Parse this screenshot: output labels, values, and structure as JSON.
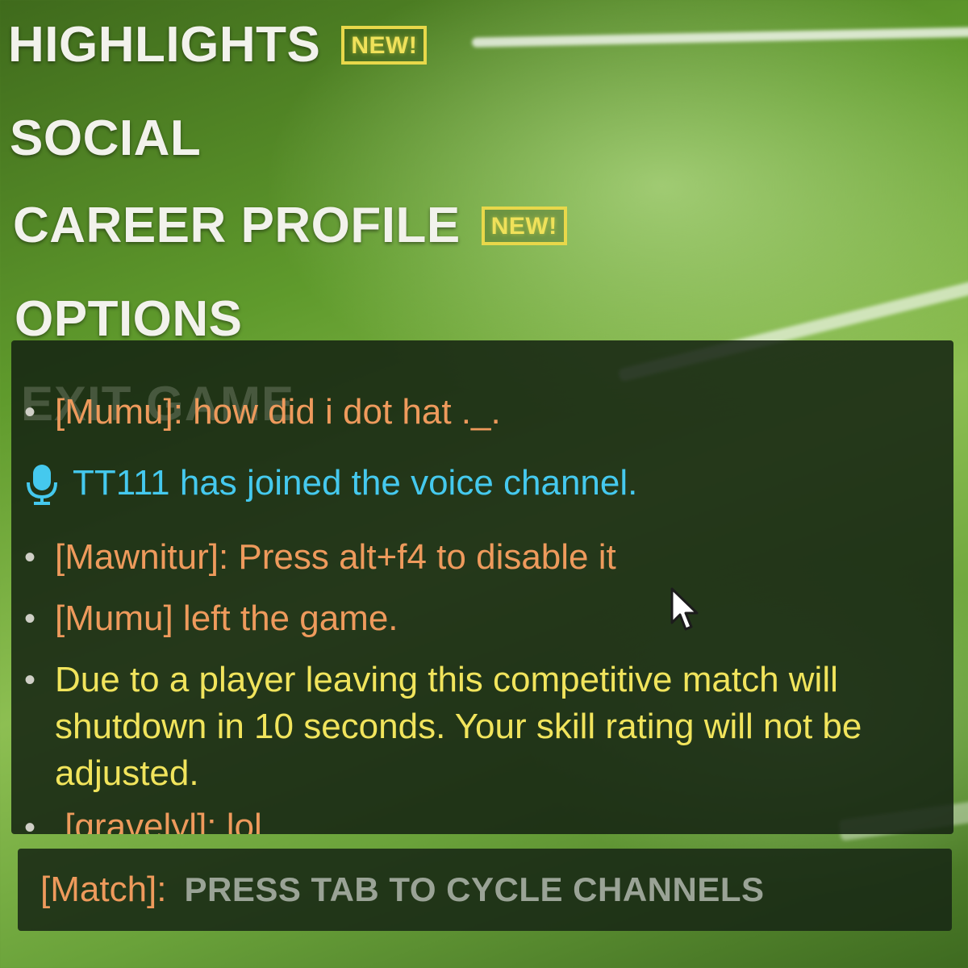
{
  "menu": {
    "items": [
      {
        "label": "HIGHLIGHTS",
        "badge": "NEW!"
      },
      {
        "label": "SOCIAL"
      },
      {
        "label": "CAREER PROFILE",
        "badge": "NEW!"
      },
      {
        "label": "OPTIONS"
      },
      {
        "label": "EXIT GAME"
      }
    ]
  },
  "chat": {
    "messages": [
      {
        "type": "player",
        "text": "[Mumu]: how did i dot hat ._."
      },
      {
        "type": "voice",
        "icon": "microphone-icon",
        "text": "TT111 has joined the voice channel."
      },
      {
        "type": "player",
        "text": "[Mawnitur]: Press alt+f4 to disable it"
      },
      {
        "type": "player",
        "text": "[Mumu] left the game."
      },
      {
        "type": "system",
        "text": "Due to a player leaving this competitive match will shutdown in 10 seconds. Your skill rating will not be adjusted."
      },
      {
        "type": "player",
        "text": "[gravelyl]: lol"
      }
    ]
  },
  "input": {
    "channel": "[Match]:",
    "placeholder": "PRESS TAB TO CYCLE CHANNELS"
  },
  "colors": {
    "player": "#ee9a5c",
    "system": "#f1e45c",
    "voice": "#45c9ee",
    "badge": "#e8d84a"
  }
}
